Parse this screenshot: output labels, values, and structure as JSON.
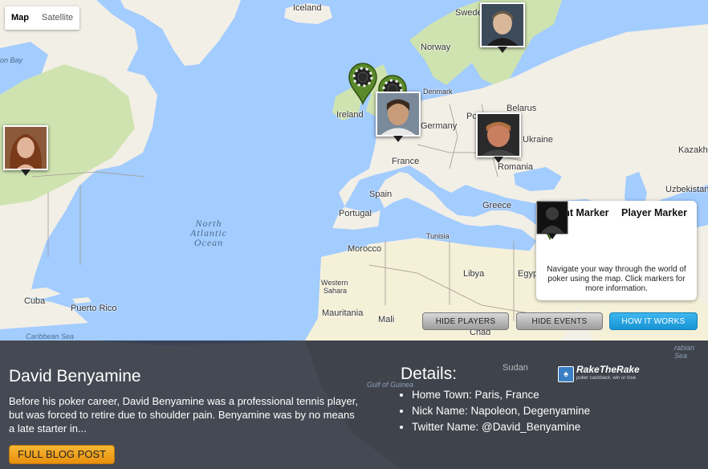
{
  "map_type": {
    "options": [
      "Map",
      "Satellite"
    ],
    "selected": "Map"
  },
  "places": {
    "iceland": "Iceland",
    "sweden": "Swede",
    "norway": "Norway",
    "denmark": "Denmark",
    "ireland": "Ireland",
    "germany": "Germany",
    "belarus": "Belarus",
    "poland": "Po",
    "ukraine": "Ukraine",
    "kazakh": "Kazakh",
    "france": "France",
    "romania": "Romania",
    "uzbekistan": "Uzbekistan",
    "spain": "Spain",
    "portugal": "Portugal",
    "greece": "Greece",
    "tunisia": "Tunisia",
    "morocco": "Morocco",
    "libya": "Libya",
    "egypt": "Egyp",
    "western_sahara_1": "Western",
    "western_sahara_2": "Sahara",
    "mauritania": "Mauritania",
    "mali": "Mali",
    "chad": "Chad",
    "sudan": "Sudan",
    "cuba": "Cuba",
    "puerto_rico": "Puerto Rico",
    "baffin_bay": "on Bay",
    "north_atlantic_1": "North",
    "north_atlantic_2": "Atlantic",
    "north_atlantic_3": "Ocean",
    "caribbean_sea": "Caribbean Sea",
    "arabian_sea": "rabian Sea",
    "gulf_of_guinea": "Gulf of Guinea"
  },
  "legend": {
    "event_title": "Event Marker",
    "player_title": "Player Marker",
    "description": "Navigate your way through the world of poker using the map. Click markers for more information."
  },
  "buttons": {
    "hide_players": "HIDE PLAYERS",
    "hide_events": "HIDE EVENTS",
    "how_it_works": "HOW IT WORKS"
  },
  "player": {
    "name": "David Benyamine",
    "bio": "Before his poker career, David Benyamine was a professional tennis player, but was forced to retire due to shoulder pain. Benyamine was by no means a late starter in...",
    "blog_button": "FULL BLOG POST"
  },
  "details": {
    "title": "Details:",
    "items": [
      "Home Town: Paris, France",
      "Nick Name: Napoleon, Degenyamine",
      "Twitter Name: @David_Benyamine"
    ]
  },
  "brand": {
    "name": "RakeTheRake",
    "tagline": "poker cashback, win or lose"
  },
  "colors": {
    "water": "#a3ccff",
    "land": "#f2efe6",
    "green_land": "#cfe3b0",
    "desert": "#f5f0d8",
    "event_marker": "#5a8a2a",
    "panel": "#282d3a",
    "blue_button": "#1794d4",
    "orange_button": "#f0a020"
  }
}
